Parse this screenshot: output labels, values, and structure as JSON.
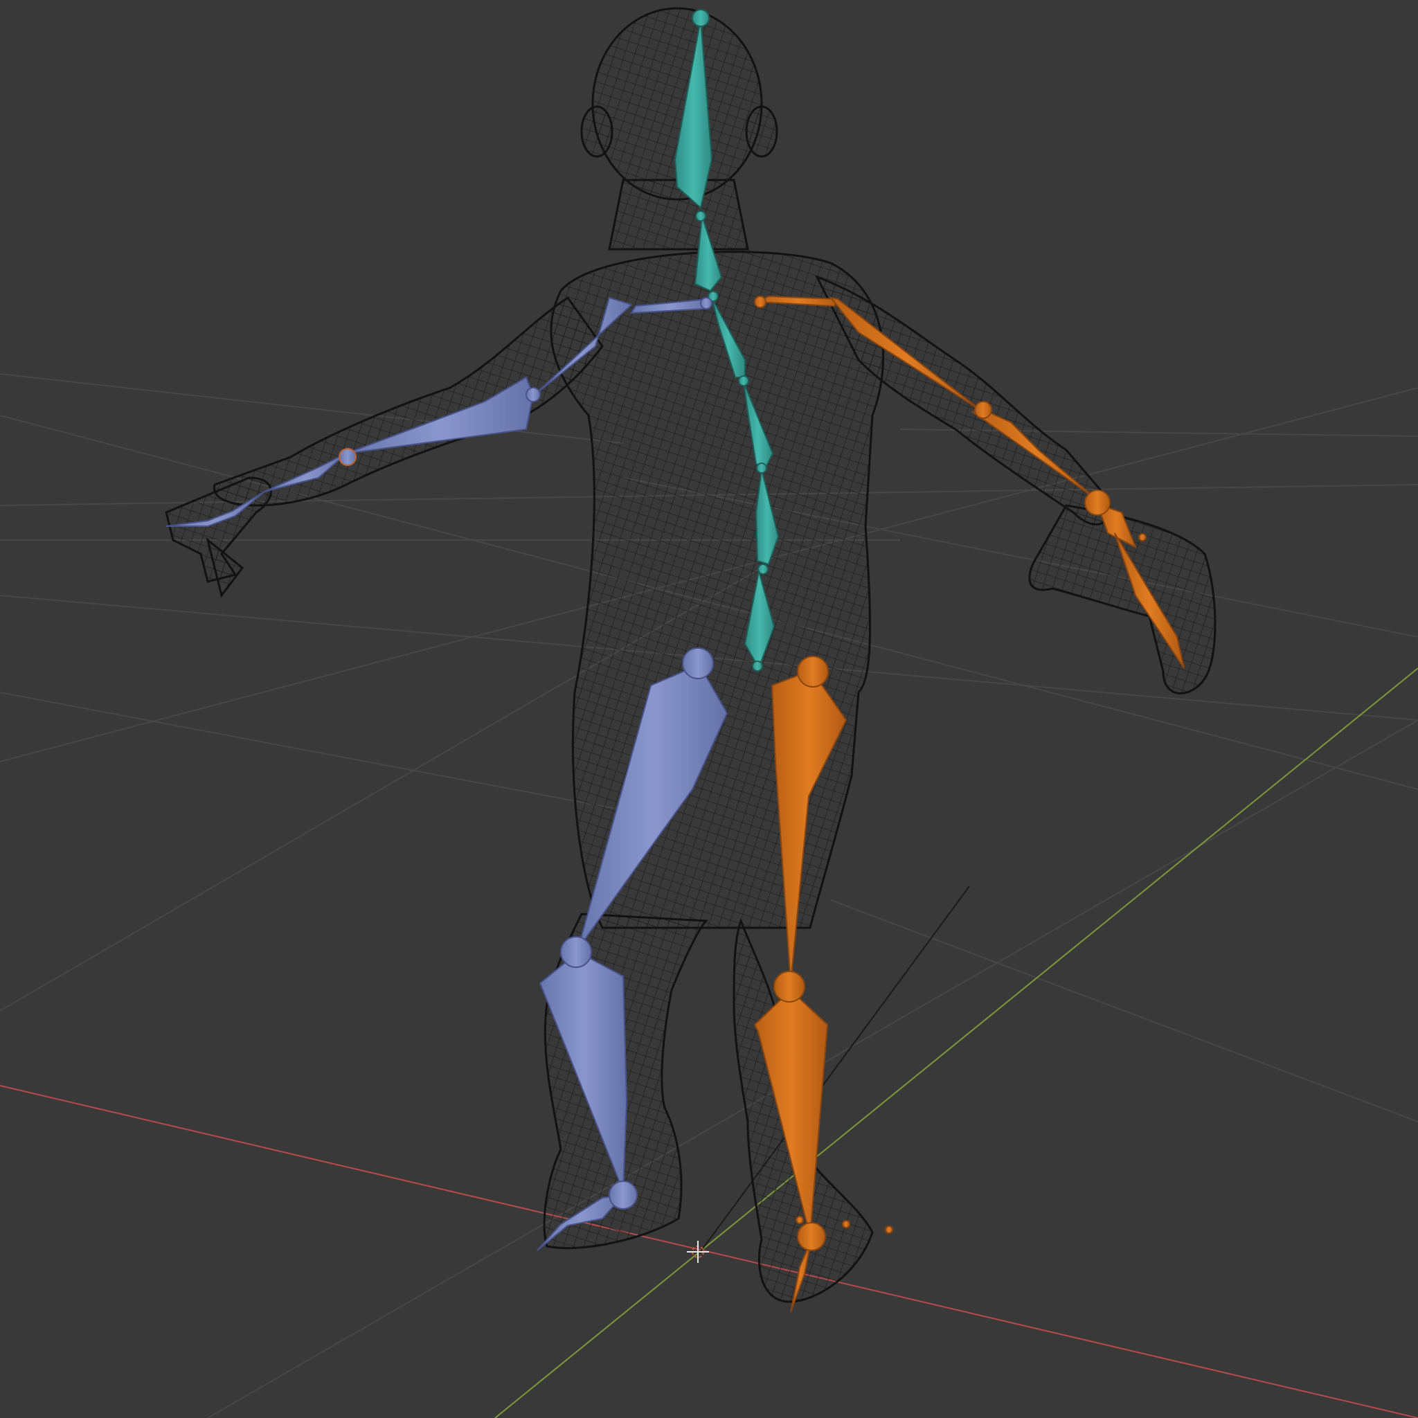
{
  "viewport": {
    "background": "#393939",
    "grid_color": "#4a4a4a",
    "x_axis_color": "#b84a4a",
    "y_axis_color": "#7a9a3a",
    "wireframe_color": "#141414"
  },
  "armature": {
    "center_bone_color": "#3aa69c",
    "left_bone_color": "#7a88c0",
    "right_bone_color": "#d4731f"
  },
  "icons": {
    "origin": "3d-cursor-icon"
  }
}
